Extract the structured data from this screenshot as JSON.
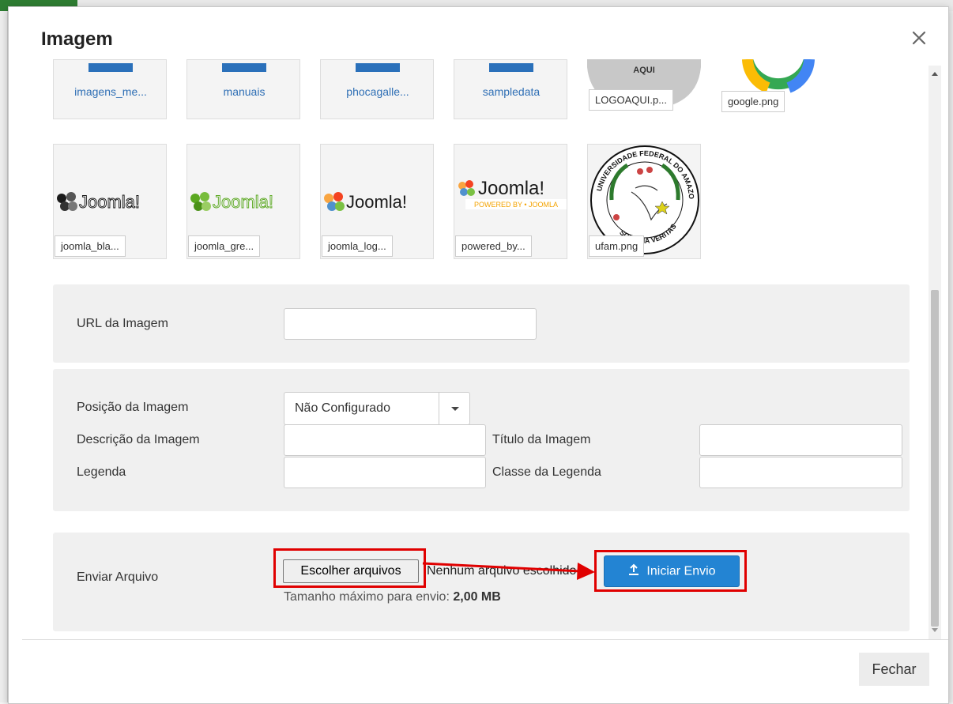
{
  "modal": {
    "title": "Imagem",
    "close_label": "×",
    "footer_button": "Fechar"
  },
  "media": {
    "row1": [
      {
        "name": "imagens_me...",
        "kind": "folder"
      },
      {
        "name": "manuais",
        "kind": "folder"
      },
      {
        "name": "phocagalle...",
        "kind": "folder"
      },
      {
        "name": "sampledata",
        "kind": "folder"
      },
      {
        "name": "LOGOAQUI.p...",
        "kind": "image",
        "image_text": "AQUI"
      },
      {
        "name": "google.png",
        "kind": "image"
      }
    ],
    "row2": [
      {
        "name": "joomla_bla...",
        "kind": "image",
        "logo_text": "Joomla!"
      },
      {
        "name": "joomla_gre...",
        "kind": "image",
        "logo_text": "Joomla!"
      },
      {
        "name": "joomla_log...",
        "kind": "image",
        "logo_text": "Joomla!"
      },
      {
        "name": "powered_by...",
        "kind": "image",
        "logo_text": "Joomla!",
        "logo_sub": "POWERED BY • JOOMLA"
      },
      {
        "name": "ufam.png",
        "kind": "image",
        "seal_text": "UNIVERSIDADE FEDERAL DO AMAZONAS",
        "seal_motto": "SCIENTIA VERITAS"
      }
    ]
  },
  "url_panel": {
    "label": "URL da Imagem",
    "value": ""
  },
  "props_panel": {
    "position_label": "Posição da Imagem",
    "position_value": "Não Configurado",
    "description_label": "Descrição da Imagem",
    "description_value": "",
    "title_label": "Título da Imagem",
    "title_value": "",
    "caption_label": "Legenda",
    "caption_value": "",
    "caption_class_label": "Classe da Legenda",
    "caption_class_value": ""
  },
  "upload_panel": {
    "label": "Enviar Arquivo",
    "choose_button": "Escolher arquivos",
    "no_file_text": "Nenhum arquivo escolhido",
    "start_button": "Iniciar Envio",
    "max_size_text": "Tamanho máximo para envio:",
    "max_size_value": "2,00 MB"
  },
  "colors": {
    "primary": "#2384d3",
    "annotation": "#e00000",
    "folder": "#2a70ba",
    "panel_bg": "#f0f0f0"
  }
}
